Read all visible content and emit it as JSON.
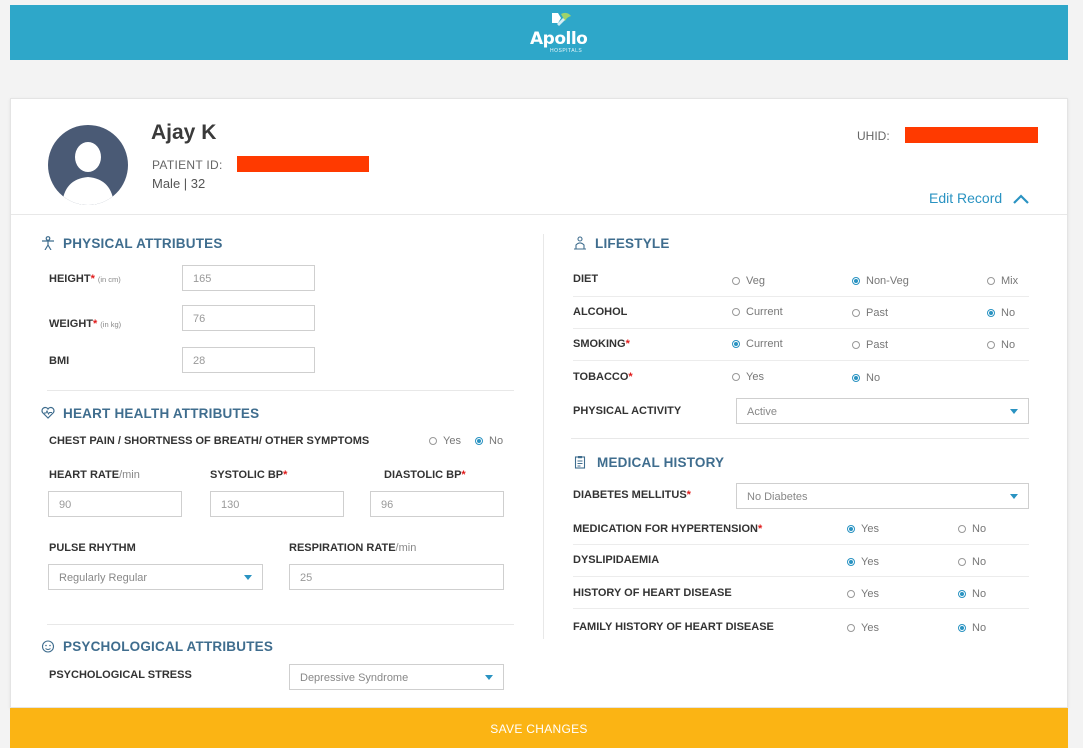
{
  "brand": {
    "name": "Apollo",
    "subtitle": "HOSPITALS"
  },
  "patient": {
    "name": "Ajay K",
    "id_label": "PATIENT ID:",
    "gender_age": "Male | 32",
    "uhid_label": "UHID:"
  },
  "edit_record": "Edit Record",
  "physical": {
    "title": "PHYSICAL ATTRIBUTES",
    "height": {
      "label": "HEIGHT",
      "unit": "(in cm)",
      "value": "165"
    },
    "weight": {
      "label": "WEIGHT",
      "unit": "(in kg)",
      "value": "76"
    },
    "bmi": {
      "label": "BMI",
      "value": "28"
    }
  },
  "heart": {
    "title": "HEART HEALTH ATTRIBUTES",
    "chest_pain": {
      "label": "CHEST PAIN / SHORTNESS OF BREATH/ OTHER SYMPTOMS",
      "options": [
        "Yes",
        "No"
      ],
      "selected": "No"
    },
    "heart_rate": {
      "label": "HEART RATE",
      "unit": "/min",
      "value": "90"
    },
    "systolic": {
      "label": "SYSTOLIC BP",
      "value": "130"
    },
    "diastolic": {
      "label": "DIASTOLIC BP",
      "value": "96"
    },
    "pulse": {
      "label": "PULSE RHYTHM",
      "value": "Regularly Regular"
    },
    "respiration": {
      "label": "RESPIRATION RATE",
      "unit": "/min",
      "value": "25"
    }
  },
  "psych": {
    "title": "PSYCHOLOGICAL ATTRIBUTES",
    "stress": {
      "label": "PSYCHOLOGICAL STRESS",
      "value": "Depressive Syndrome"
    }
  },
  "lifestyle": {
    "title": "LIFESTYLE",
    "diet": {
      "label": "DIET",
      "options": [
        "Veg",
        "Non-Veg",
        "Mix"
      ],
      "selected": "Non-Veg"
    },
    "alcohol": {
      "label": "ALCOHOL",
      "options": [
        "Current",
        "Past",
        "No"
      ],
      "selected": "No"
    },
    "smoking": {
      "label": "SMOKING",
      "options": [
        "Current",
        "Past",
        "No"
      ],
      "selected": "Current"
    },
    "tobacco": {
      "label": "TOBACCO",
      "options": [
        "Yes",
        "No"
      ],
      "selected": "No"
    },
    "activity": {
      "label": "PHYSICAL ACTIVITY",
      "value": "Active"
    }
  },
  "medical": {
    "title": "MEDICAL HISTORY",
    "diabetes": {
      "label": "DIABETES MELLITUS",
      "value": "No Diabetes"
    },
    "hypertension": {
      "label": "MEDICATION FOR HYPERTENSION",
      "options": [
        "Yes",
        "No"
      ],
      "selected": "Yes"
    },
    "dyslipidaemia": {
      "label": "DYSLIPIDAEMIA",
      "options": [
        "Yes",
        "No"
      ],
      "selected": "Yes"
    },
    "heart_disease": {
      "label": "HISTORY OF HEART DISEASE",
      "options": [
        "Yes",
        "No"
      ],
      "selected": "No"
    },
    "family_heart": {
      "label": "FAMILY HISTORY OF HEART DISEASE",
      "options": [
        "Yes",
        "No"
      ],
      "selected": "No"
    }
  },
  "save_label": "SAVE CHANGES",
  "colors": {
    "brand": "#2ea7c9",
    "accent": "#2a93c2",
    "save": "#fbb414",
    "required": "#e01b1b",
    "redaction": "#ff3a00"
  }
}
